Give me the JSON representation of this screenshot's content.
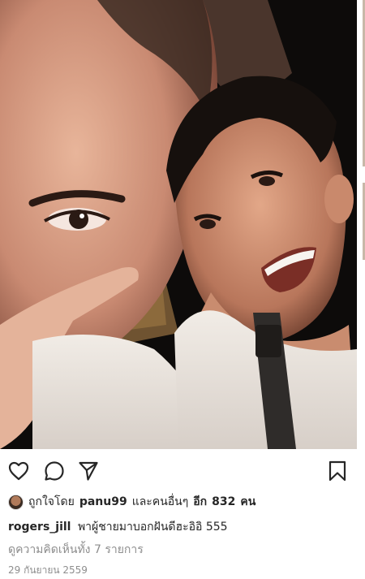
{
  "photo": {
    "icon": "selfie-photo",
    "description_colors": {
      "background": "#0d0b0a",
      "skin_warm": "#d9a98a",
      "shirt": "#e8e2dc"
    }
  },
  "actions": {
    "like_icon": "heart-icon",
    "comment_icon": "comment-icon",
    "share_icon": "send-icon",
    "save_icon": "bookmark-icon"
  },
  "likes": {
    "prefix": "ถูกใจโดย",
    "user": "panu99",
    "middle": "และคนอื่นๆ",
    "more_word": "อีก",
    "count": "832",
    "suffix": "คน"
  },
  "caption": {
    "username": "rogers_jill",
    "text": "พาผู้ชายมาบอกฝันดีฮะอิอิ 555"
  },
  "comments": {
    "label": "ดูความคิดเห็นทั้ง 7 รายการ"
  },
  "date": "29 กันยายน 2559"
}
